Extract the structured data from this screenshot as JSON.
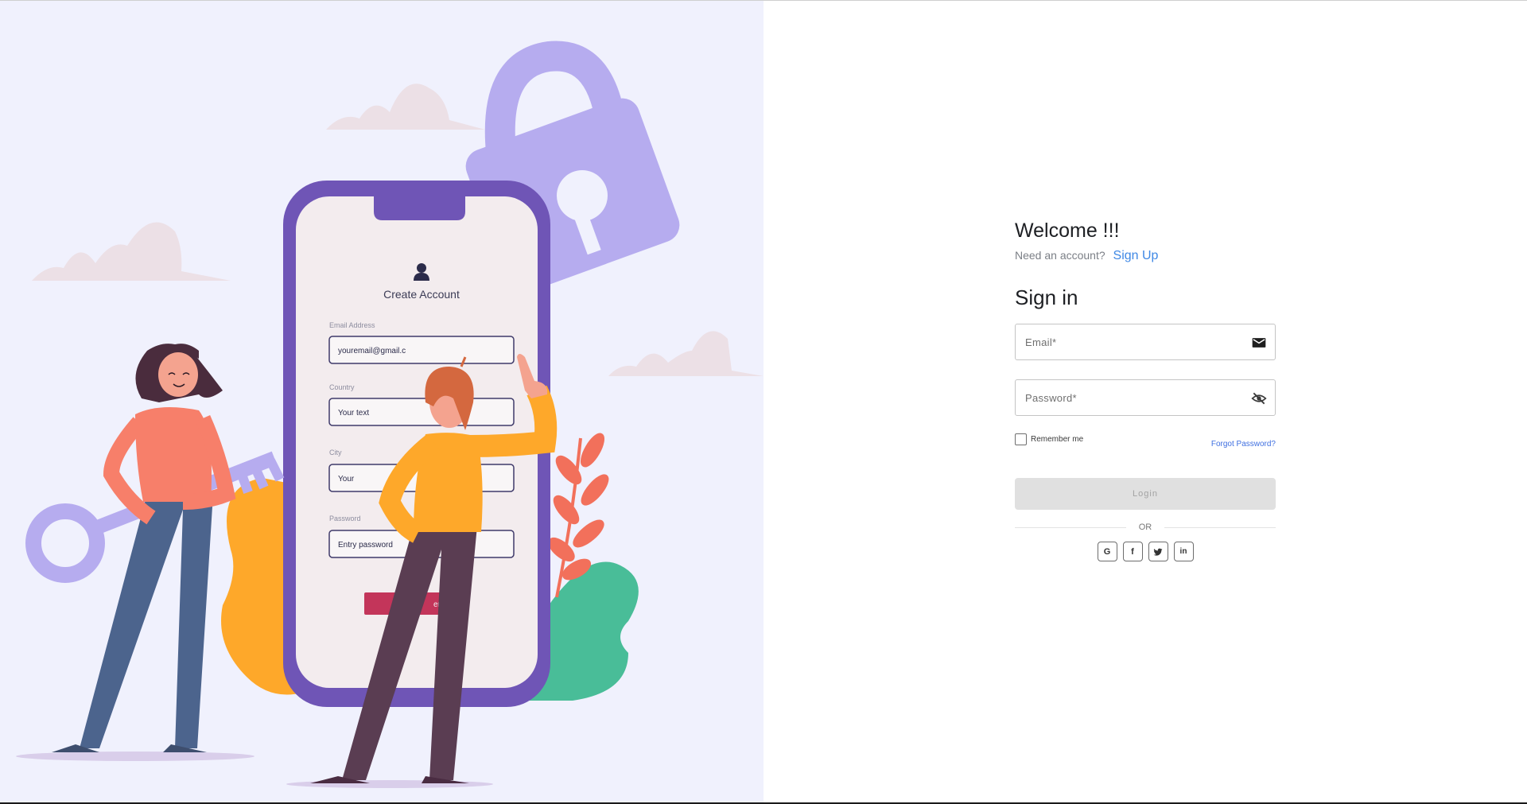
{
  "illustration": {
    "phone_form": {
      "title": "Create Account",
      "email_label": "Email Address",
      "email_value": "youremail@gmail.c",
      "country_label": "Country",
      "country_value": "Your text",
      "city_label": "City",
      "city_value": "Your",
      "password_label": "Password",
      "password_value": "Entry password",
      "button_label": "er"
    }
  },
  "welcome": {
    "title": "Welcome !!!",
    "need_account": "Need an account?",
    "signup_link": "Sign Up"
  },
  "signin": {
    "title": "Sign in",
    "email_placeholder": "Email*",
    "password_placeholder": "Password*",
    "remember_label": "Remember me",
    "forgot_link": "Forgot Password?",
    "login_label": "Login",
    "or_label": "OR"
  },
  "social": [
    {
      "name": "google-icon",
      "glyph": "G"
    },
    {
      "name": "facebook-icon",
      "glyph": "f"
    },
    {
      "name": "twitter-icon",
      "glyph": "t"
    },
    {
      "name": "linkedin-icon",
      "glyph": "in"
    }
  ],
  "colors": {
    "accent_link": "#3f88e5",
    "illustration_bg": "#f0f1fd",
    "phone_purple": "#6f55b6",
    "lock_lavender": "#b6acef",
    "login_disabled_bg": "#e0e0e0"
  }
}
